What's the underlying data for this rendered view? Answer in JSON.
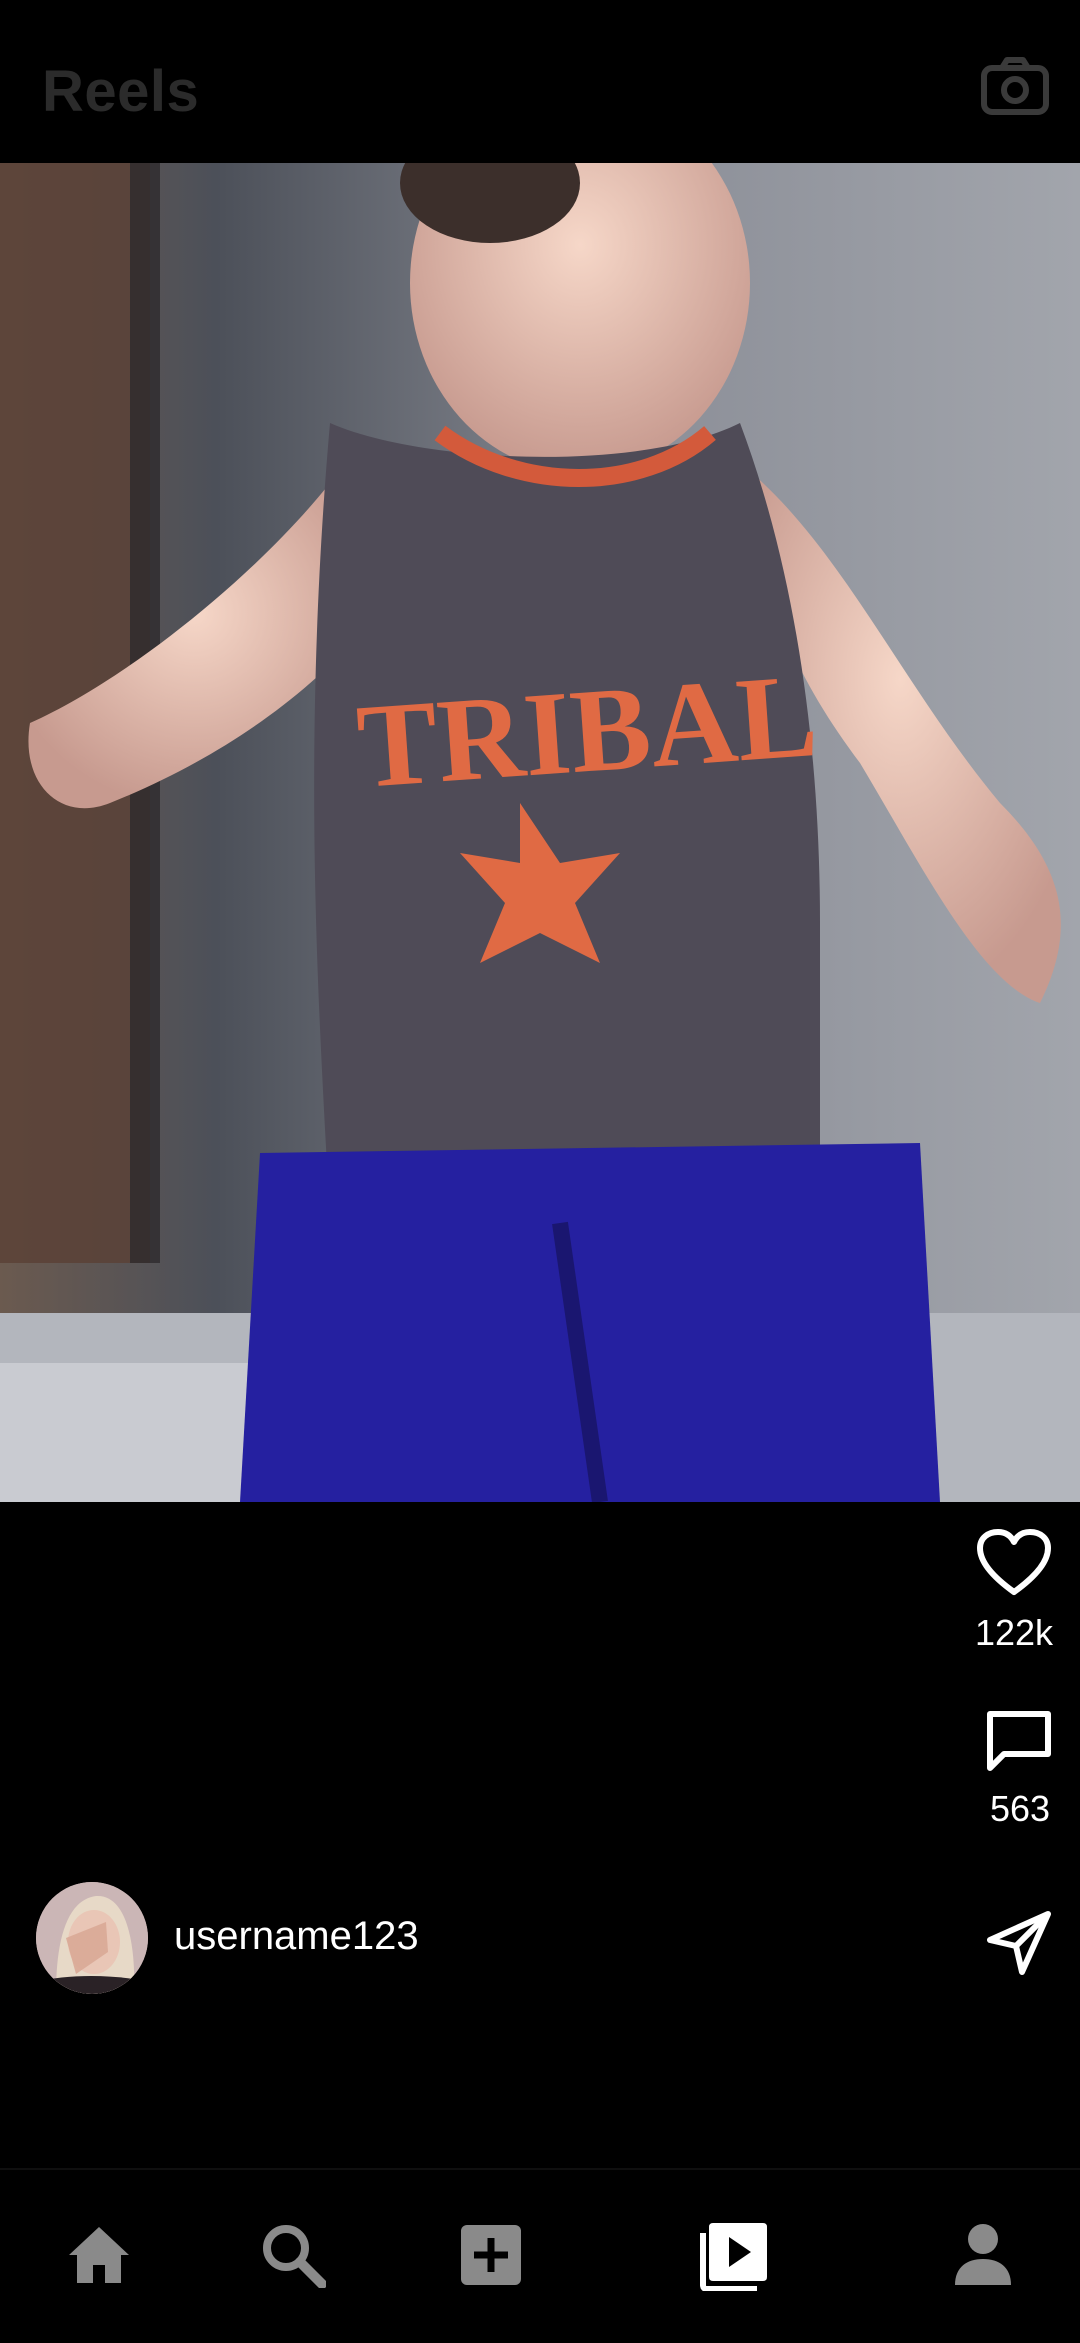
{
  "header": {
    "title": "Reels",
    "camera_icon": "camera-icon"
  },
  "reel": {
    "video_description_icon": "video-frame",
    "likes": "122k",
    "comments": "563",
    "username": "username123",
    "icons": {
      "like": "heart-icon",
      "comment": "comment-icon",
      "share": "send-icon"
    }
  },
  "bottom_nav": {
    "items": [
      {
        "name": "home",
        "icon": "home-icon"
      },
      {
        "name": "search",
        "icon": "search-icon"
      },
      {
        "name": "create",
        "icon": "add-post-icon"
      },
      {
        "name": "reels",
        "icon": "reels-icon",
        "active": true
      },
      {
        "name": "profile",
        "icon": "profile-icon"
      }
    ]
  },
  "colors": {
    "background": "#000000",
    "header_title": "#2b2b2b",
    "icon_inactive": "#8a8a8a",
    "icon_active": "#ffffff"
  }
}
